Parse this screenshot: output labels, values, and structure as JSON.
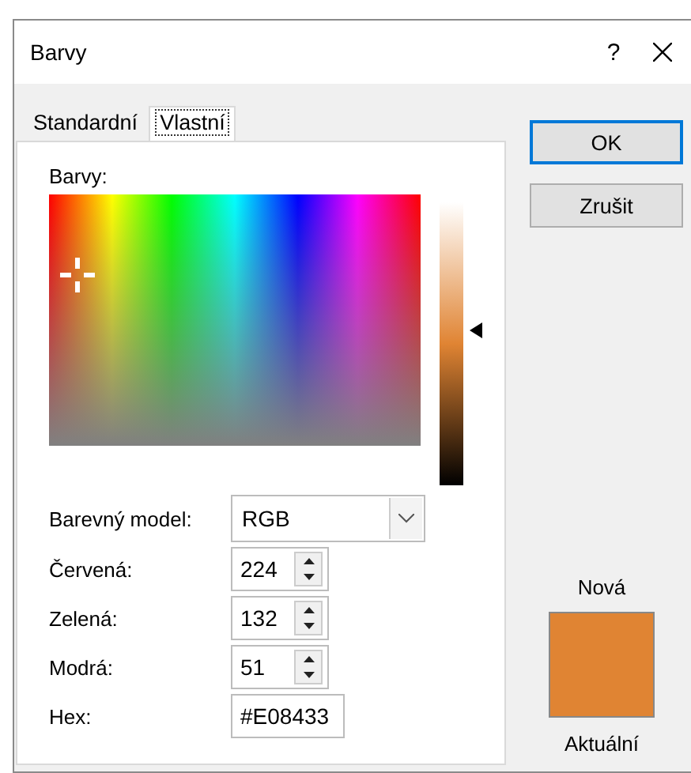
{
  "window": {
    "title": "Barvy",
    "help": "?"
  },
  "tabs": [
    {
      "label": "Standardní",
      "selected": false
    },
    {
      "label": "Vlastní",
      "selected": true
    }
  ],
  "colors_label": "Barvy:",
  "luminance": {
    "level": 0.55
  },
  "model": {
    "label": "Barevný model:",
    "value": "RGB"
  },
  "channels": [
    {
      "label": "Červená:",
      "value": "224"
    },
    {
      "label": "Zelená:",
      "value": "132"
    },
    {
      "label": "Modrá:",
      "value": "51"
    }
  ],
  "hex": {
    "label": "Hex:",
    "value": "#E08433"
  },
  "buttons": [
    {
      "label": "OK",
      "default": true
    },
    {
      "label": "Zrušit",
      "default": false
    }
  ],
  "preview": {
    "new_label": "Nová",
    "color": "#e08433",
    "current_label": "Aktuální"
  }
}
